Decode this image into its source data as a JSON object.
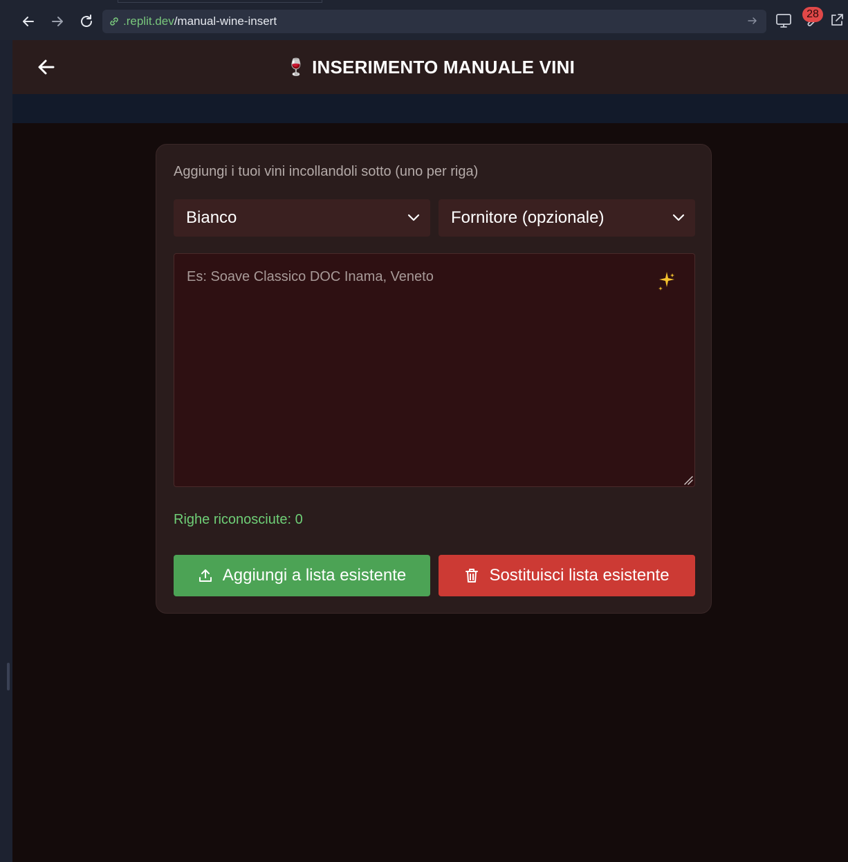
{
  "browser": {
    "url_domain": ".replit.dev",
    "url_path": "/manual-wine-insert",
    "badge_count": "28",
    "icons": [
      "back-icon",
      "forward-icon",
      "reload-icon",
      "link-icon",
      "arrow-right-icon",
      "monitor-icon",
      "wrench-icon",
      "external-link-icon"
    ]
  },
  "header": {
    "title_emoji": "🍷",
    "title": "INSERIMENTO MANUALE VINI",
    "back_icon": "arrow-left-icon"
  },
  "card": {
    "instruction": "Aggiungi i tuoi vini incollandoli sotto (uno per riga)",
    "type_select": {
      "selected": "Bianco"
    },
    "supplier_select": {
      "selected": "Fornitore (opzionale)"
    },
    "textarea": {
      "placeholder": "Es: Soave Classico DOC Inama, Veneto",
      "value": ""
    },
    "recognized_rows": "Righe riconosciute: 0",
    "add_button": "Aggiungi a lista esistente",
    "replace_button": "Sostituisci lista esistente"
  },
  "colors": {
    "page_bg": "#140b0b",
    "card_bg": "#2a1c1c",
    "add_green": "#4ca355",
    "replace_red": "#cc3a34",
    "count_green": "#6fcf77",
    "sparkle_gold": "#f2c12e"
  }
}
